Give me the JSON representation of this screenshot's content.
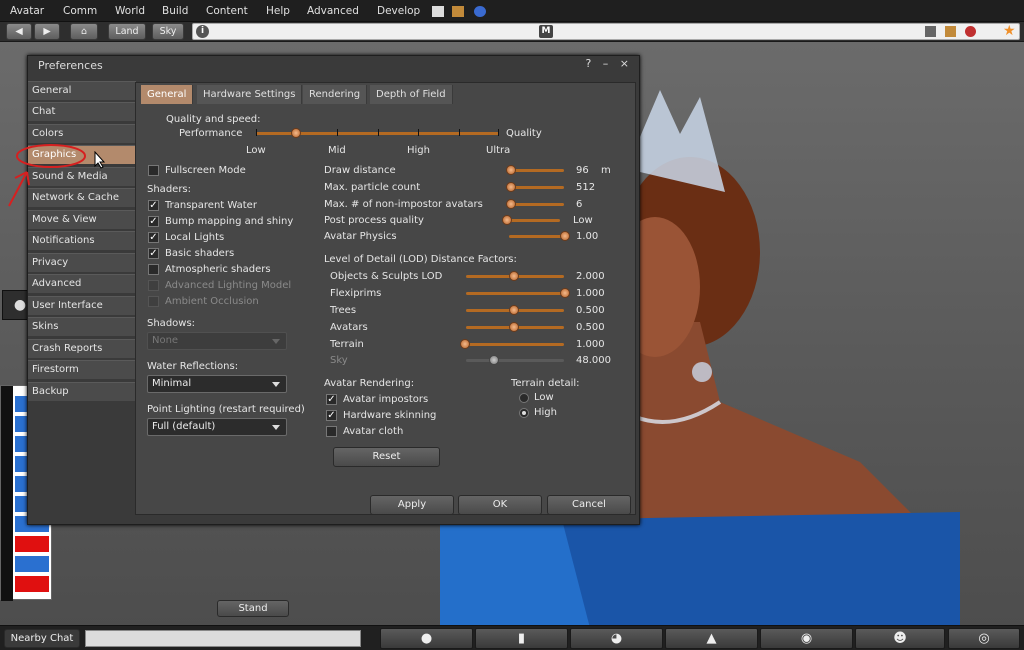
{
  "menubar": {
    "items": [
      "Avatar",
      "Comm",
      "World",
      "Build",
      "Content",
      "Help",
      "Advanced",
      "Develop"
    ]
  },
  "navbar": {
    "land_label": "Land",
    "sky_label": "Sky",
    "m_badge": "M"
  },
  "prefs": {
    "title": "Preferences",
    "window_controls": "? – ×",
    "categories": [
      "General",
      "Chat",
      "Colors",
      "Graphics",
      "Sound & Media",
      "Network & Cache",
      "Move & View",
      "Notifications",
      "Privacy",
      "Advanced",
      "User Interface",
      "Skins",
      "Crash Reports",
      "Firestorm",
      "Backup"
    ],
    "selected_category": "Graphics",
    "tabs": [
      "General",
      "Hardware Settings",
      "Rendering",
      "Depth of Field"
    ],
    "selected_tab": "General",
    "quality": {
      "label": "Quality and speed:",
      "left": "Performance",
      "right": "Quality",
      "marks": [
        "Low",
        "Mid",
        "High",
        "Ultra"
      ],
      "level": 0.16
    },
    "fullscreen_label": "Fullscreen Mode",
    "shaders_label": "Shaders:",
    "shaders": [
      {
        "label": "Transparent Water",
        "checked": true,
        "enabled": true
      },
      {
        "label": "Bump mapping and shiny",
        "checked": true,
        "enabled": true
      },
      {
        "label": "Local Lights",
        "checked": true,
        "enabled": true
      },
      {
        "label": "Basic shaders",
        "checked": true,
        "enabled": true
      },
      {
        "label": "Atmospheric shaders",
        "checked": false,
        "enabled": true
      },
      {
        "label": "Advanced Lighting Model",
        "checked": false,
        "enabled": false
      },
      {
        "label": "Ambient Occlusion",
        "checked": false,
        "enabled": false
      }
    ],
    "shadows_label": "Shadows:",
    "shadows_value": "None",
    "water_label": "Water Reflections:",
    "water_value": "Minimal",
    "point_label": "Point Lighting (restart required)",
    "point_value": "Full (default)",
    "draw_settings": [
      {
        "label": "Draw distance",
        "value": "96",
        "unit": "m"
      },
      {
        "label": "Max. particle count",
        "value": "512",
        "unit": ""
      },
      {
        "label": "Max. # of non-impostor avatars",
        "value": "6",
        "unit": ""
      },
      {
        "label": "Post process quality",
        "value": "Low",
        "unit": ""
      },
      {
        "label": "Avatar Physics",
        "value": "1.00",
        "unit": ""
      }
    ],
    "lod_label": "Level of Detail (LOD) Distance Factors:",
    "lod": [
      {
        "label": "Objects & Sculpts LOD",
        "value": "2.000"
      },
      {
        "label": "Flexiprims",
        "value": "1.000"
      },
      {
        "label": "Trees",
        "value": "0.500"
      },
      {
        "label": "Avatars",
        "value": "0.500"
      },
      {
        "label": "Terrain",
        "value": "1.000"
      },
      {
        "label": "Sky",
        "value": "48.000"
      }
    ],
    "avatar_rendering_label": "Avatar Rendering:",
    "avatar_rendering": [
      {
        "label": "Avatar impostors",
        "checked": true
      },
      {
        "label": "Hardware skinning",
        "checked": true
      },
      {
        "label": "Avatar cloth",
        "checked": false
      }
    ],
    "terrain_label": "Terrain detail:",
    "terrain_options": [
      "Low",
      "High"
    ],
    "terrain_selected": "High",
    "reset_label": "Reset",
    "apply_label": "Apply",
    "ok_label": "OK",
    "cancel_label": "Cancel"
  },
  "bottom": {
    "nearby_chat": "Nearby Chat",
    "stand_label": "Stand"
  },
  "colors": {
    "accent": "#b38a6c",
    "slider": "#b46a22",
    "annotation": "#d62020"
  }
}
